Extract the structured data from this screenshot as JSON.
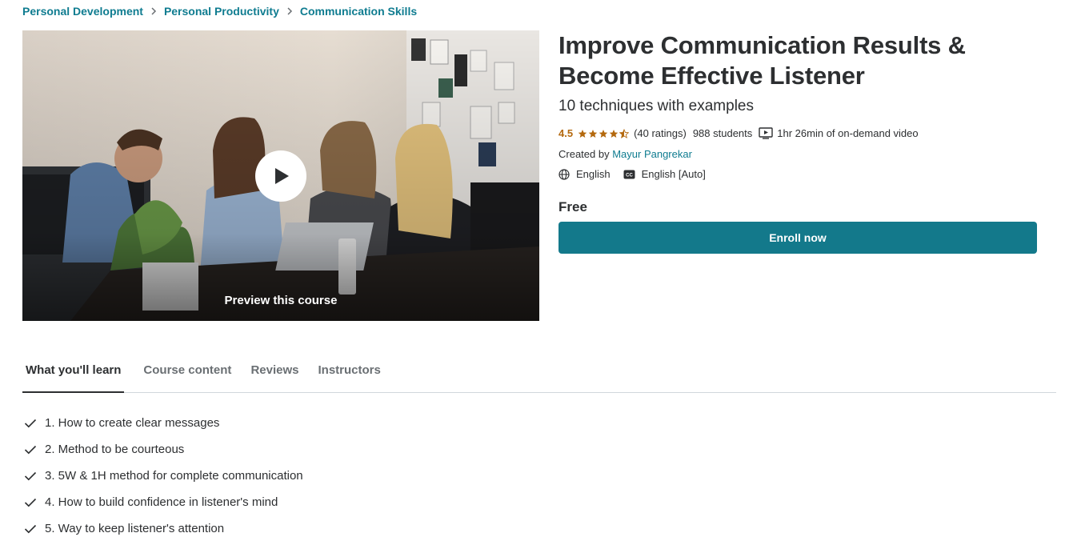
{
  "breadcrumb": [
    "Personal Development",
    "Personal Productivity",
    "Communication Skills"
  ],
  "preview": {
    "label": "Preview this course"
  },
  "course": {
    "title": "Improve Communication Results & Become Effective Listener",
    "subtitle": "10 techniques with examples",
    "rating": "4.5",
    "rating_stars": 4.5,
    "ratings_count": "(40 ratings)",
    "students": "988 students",
    "video": "1hr 26min of on-demand video",
    "created_by_label": "Created by",
    "instructor": "Mayur Pangrekar",
    "language": "English",
    "captions": "English [Auto]",
    "price": "Free",
    "enroll_label": "Enroll now"
  },
  "colors": {
    "brand": "#13798b",
    "link": "#0f7c90",
    "star": "#b4690e",
    "text": "#2d2f31"
  },
  "tabs": [
    {
      "label": "What you'll learn",
      "active": true
    },
    {
      "label": "Course content",
      "active": false
    },
    {
      "label": "Reviews",
      "active": false
    },
    {
      "label": "Instructors",
      "active": false
    }
  ],
  "learn": [
    "1. How to create clear messages",
    "2. Method to be courteous",
    "3. 5W & 1H method for complete communication",
    "4. How to build confidence in listener's mind",
    "5. Way to keep listener's attention"
  ]
}
